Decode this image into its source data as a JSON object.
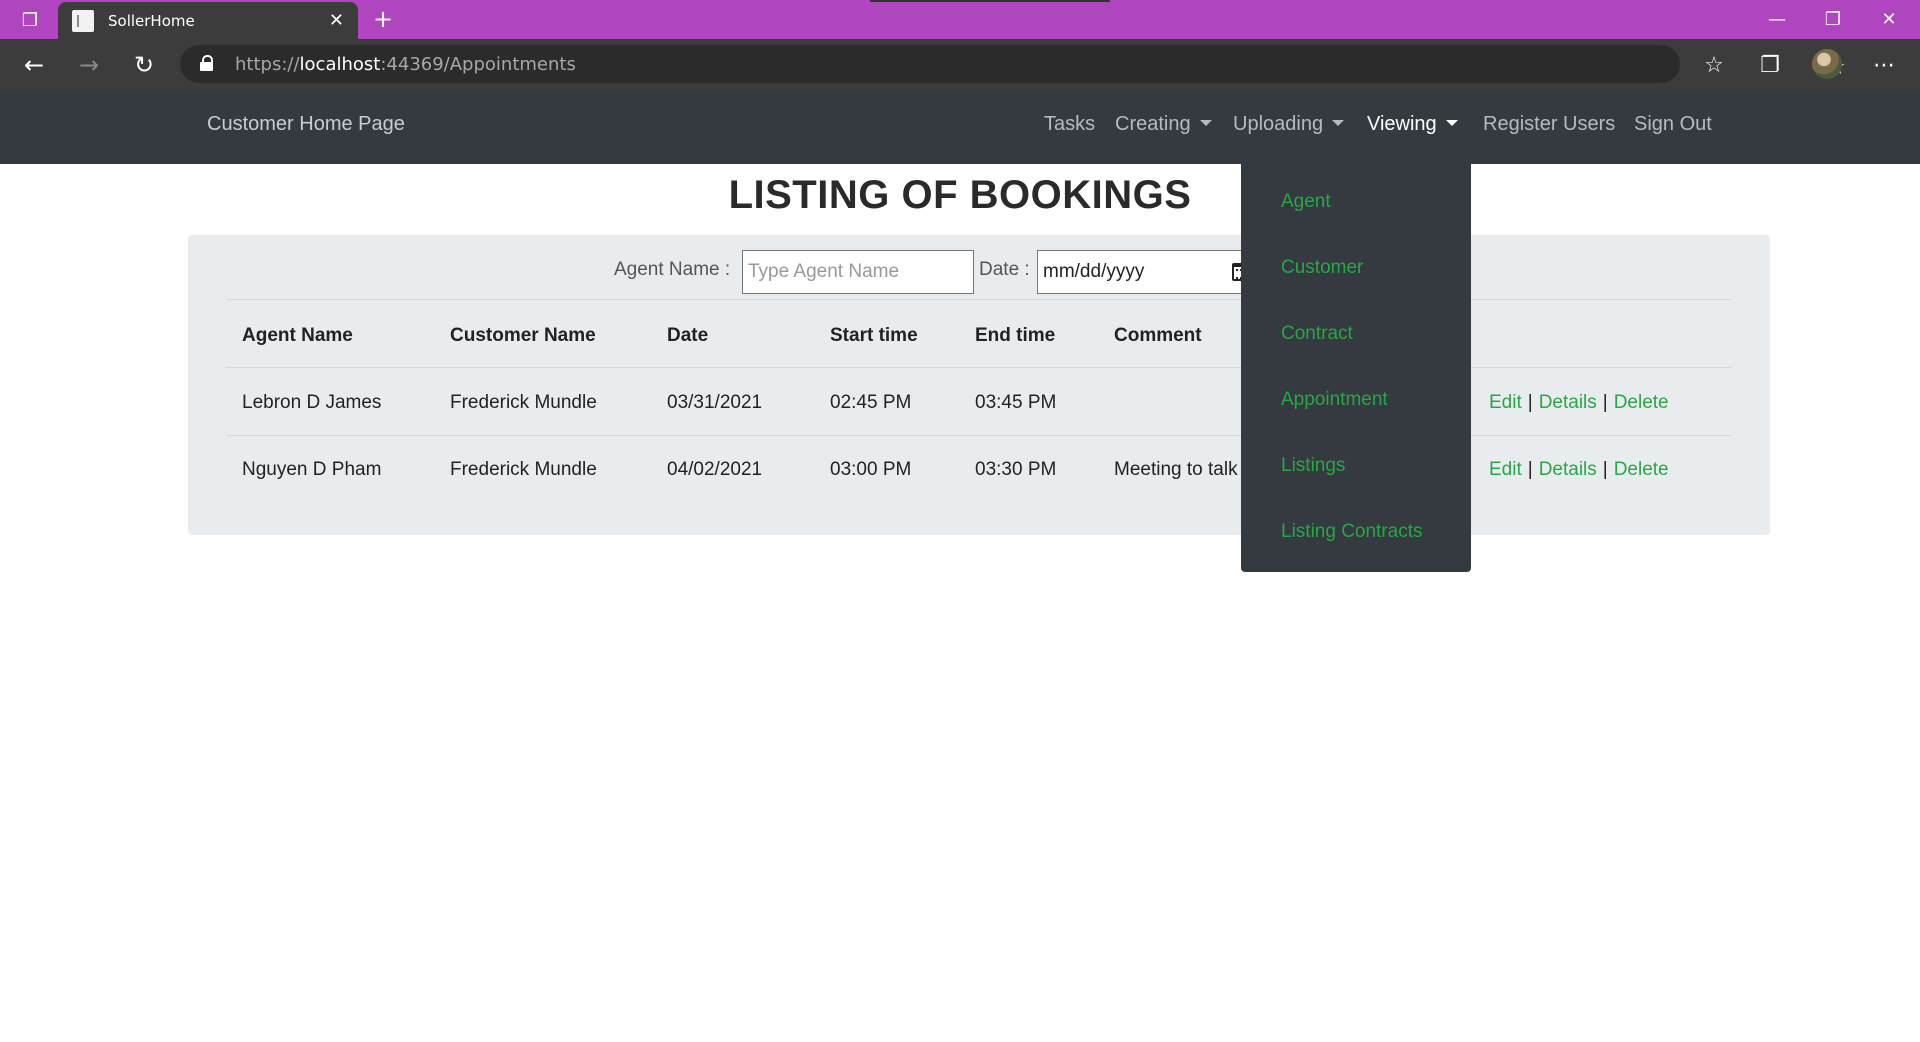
{
  "browser": {
    "tab_title": "SollerHome",
    "url_prefix": "https://",
    "url_host": "localhost",
    "url_rest": ":44369/Appointments",
    "icons": {
      "tab_actions": "tab-actions-icon",
      "favicon": "page-icon",
      "close": "close-icon",
      "new_tab": "plus-icon",
      "back": "back-arrow-icon",
      "forward": "forward-arrow-icon",
      "refresh": "refresh-icon",
      "lock": "lock-icon",
      "add_favorite": "star-plus-icon",
      "favorites": "favorites-icon",
      "collections": "collections-icon",
      "more": "ellipsis-icon"
    }
  },
  "navbar": {
    "brand": "Customer Home Page",
    "items": [
      {
        "label": "Tasks",
        "dropdown": false
      },
      {
        "label": "Creating",
        "dropdown": true
      },
      {
        "label": "Uploading",
        "dropdown": true
      },
      {
        "label": "Viewing",
        "dropdown": true,
        "active": true
      },
      {
        "label": "Register Users",
        "dropdown": false
      },
      {
        "label": "Sign Out",
        "dropdown": false
      }
    ]
  },
  "main": {
    "title": "LISTING OF BOOKINGS",
    "filters": {
      "agent_label": "Agent Name :",
      "agent_placeholder": "Type Agent Name",
      "date_label": "Date :",
      "date_value": "mm/dd/yyyy"
    },
    "table": {
      "headers": [
        "Agent Name",
        "Customer Name",
        "Date",
        "Start time",
        "End time",
        "Comment"
      ],
      "rows": [
        {
          "agent": "Lebron D James",
          "customer": "Frederick Mundle",
          "date": "03/31/2021",
          "start": "02:45 PM",
          "end": "03:45 PM",
          "comment": ""
        },
        {
          "agent": "Nguyen D Pham",
          "customer": "Frederick Mundle",
          "date": "04/02/2021",
          "start": "03:00 PM",
          "end": "03:30 PM",
          "comment": "Meeting to talk"
        }
      ],
      "actions": {
        "edit": "Edit",
        "details": "Details",
        "delete": "Delete",
        "separator": "|"
      }
    }
  },
  "viewing_dropdown": {
    "items": [
      "Agent",
      "Customer",
      "Contract",
      "Appointment",
      "Listings",
      "Listing Contracts"
    ]
  },
  "colors": {
    "titlebar": "#b045c0",
    "navbar": "#343a40",
    "link_green": "#28a745",
    "panel": "#e9ecef"
  }
}
